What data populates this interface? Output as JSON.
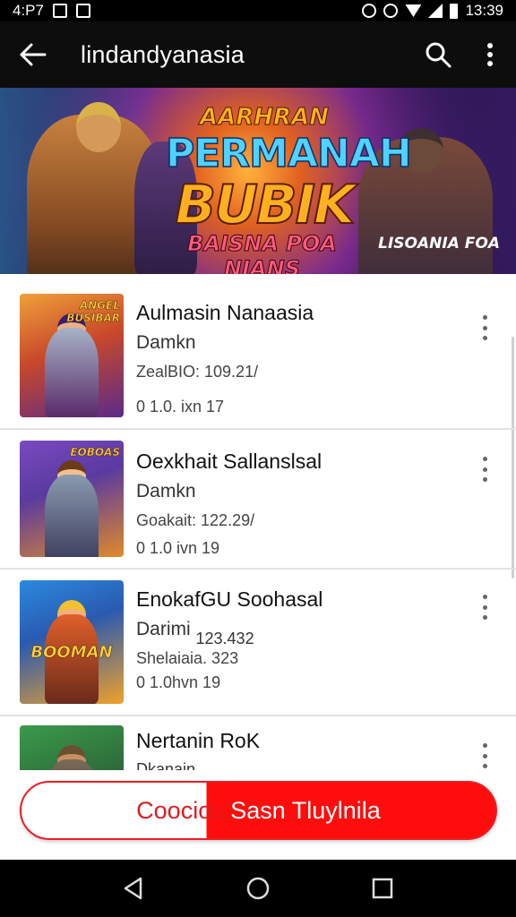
{
  "status_bar": {
    "time_left": "4:P7",
    "time_right": "13:39",
    "icons": [
      "notification-x-icon",
      "image-icon",
      "alarm-icon",
      "clock-icon",
      "wifi-icon",
      "signal-icon",
      "battery-icon"
    ]
  },
  "app_bar": {
    "title": "lindandyanasia",
    "icons": [
      "back-arrow-icon",
      "search-icon",
      "more-vert-icon"
    ]
  },
  "banner": {
    "line1": "AARHRAN",
    "line2": "PERMANAH",
    "line3": "BUBIK",
    "line4": "BAISNA POA NIANS",
    "watermark": "LISOANIA FOA"
  },
  "items": [
    {
      "name": "Aulmasin Nanaasia",
      "sub": "Damkn",
      "meta": "ZealBIO: 109.21/",
      "meta2": "0 1.0. ixn 17",
      "thumb_label": "ANGEL\nBUSIBAR",
      "colors": [
        "#e0762a",
        "#5a2a8a"
      ]
    },
    {
      "name": "Oexkhait Sallanslsal",
      "sub": "Damkn",
      "meta": "Goakait: 122.29/",
      "meta2": "0 1.0 ivn 19",
      "thumb_label": "EOBOAS",
      "colors": [
        "#6a3bb0",
        "#e08a2a"
      ]
    },
    {
      "name": "EnokafGU Soohasal",
      "sub": "Darimi",
      "sub_extra": "123.432",
      "meta": "Shelaiaia. 323",
      "meta2": "0 1.0hvn 19",
      "thumb_label": "BOOMAN",
      "colors": [
        "#2a6fcf",
        "#f0a22a"
      ]
    },
    {
      "name": "Nertanin RoK",
      "sub": "Dkanain",
      "meta": "",
      "meta2": "",
      "thumb_label": "",
      "colors": [
        "#2e8a3a",
        "#6b4a2a"
      ]
    }
  ],
  "cta": {
    "text_left": "Coocios",
    "text_right": " Sasn Tluylnila",
    "accent": "#ff0d0d"
  },
  "nav": {
    "icons": [
      "back-triangle-icon",
      "home-circle-icon",
      "recents-square-icon"
    ]
  }
}
